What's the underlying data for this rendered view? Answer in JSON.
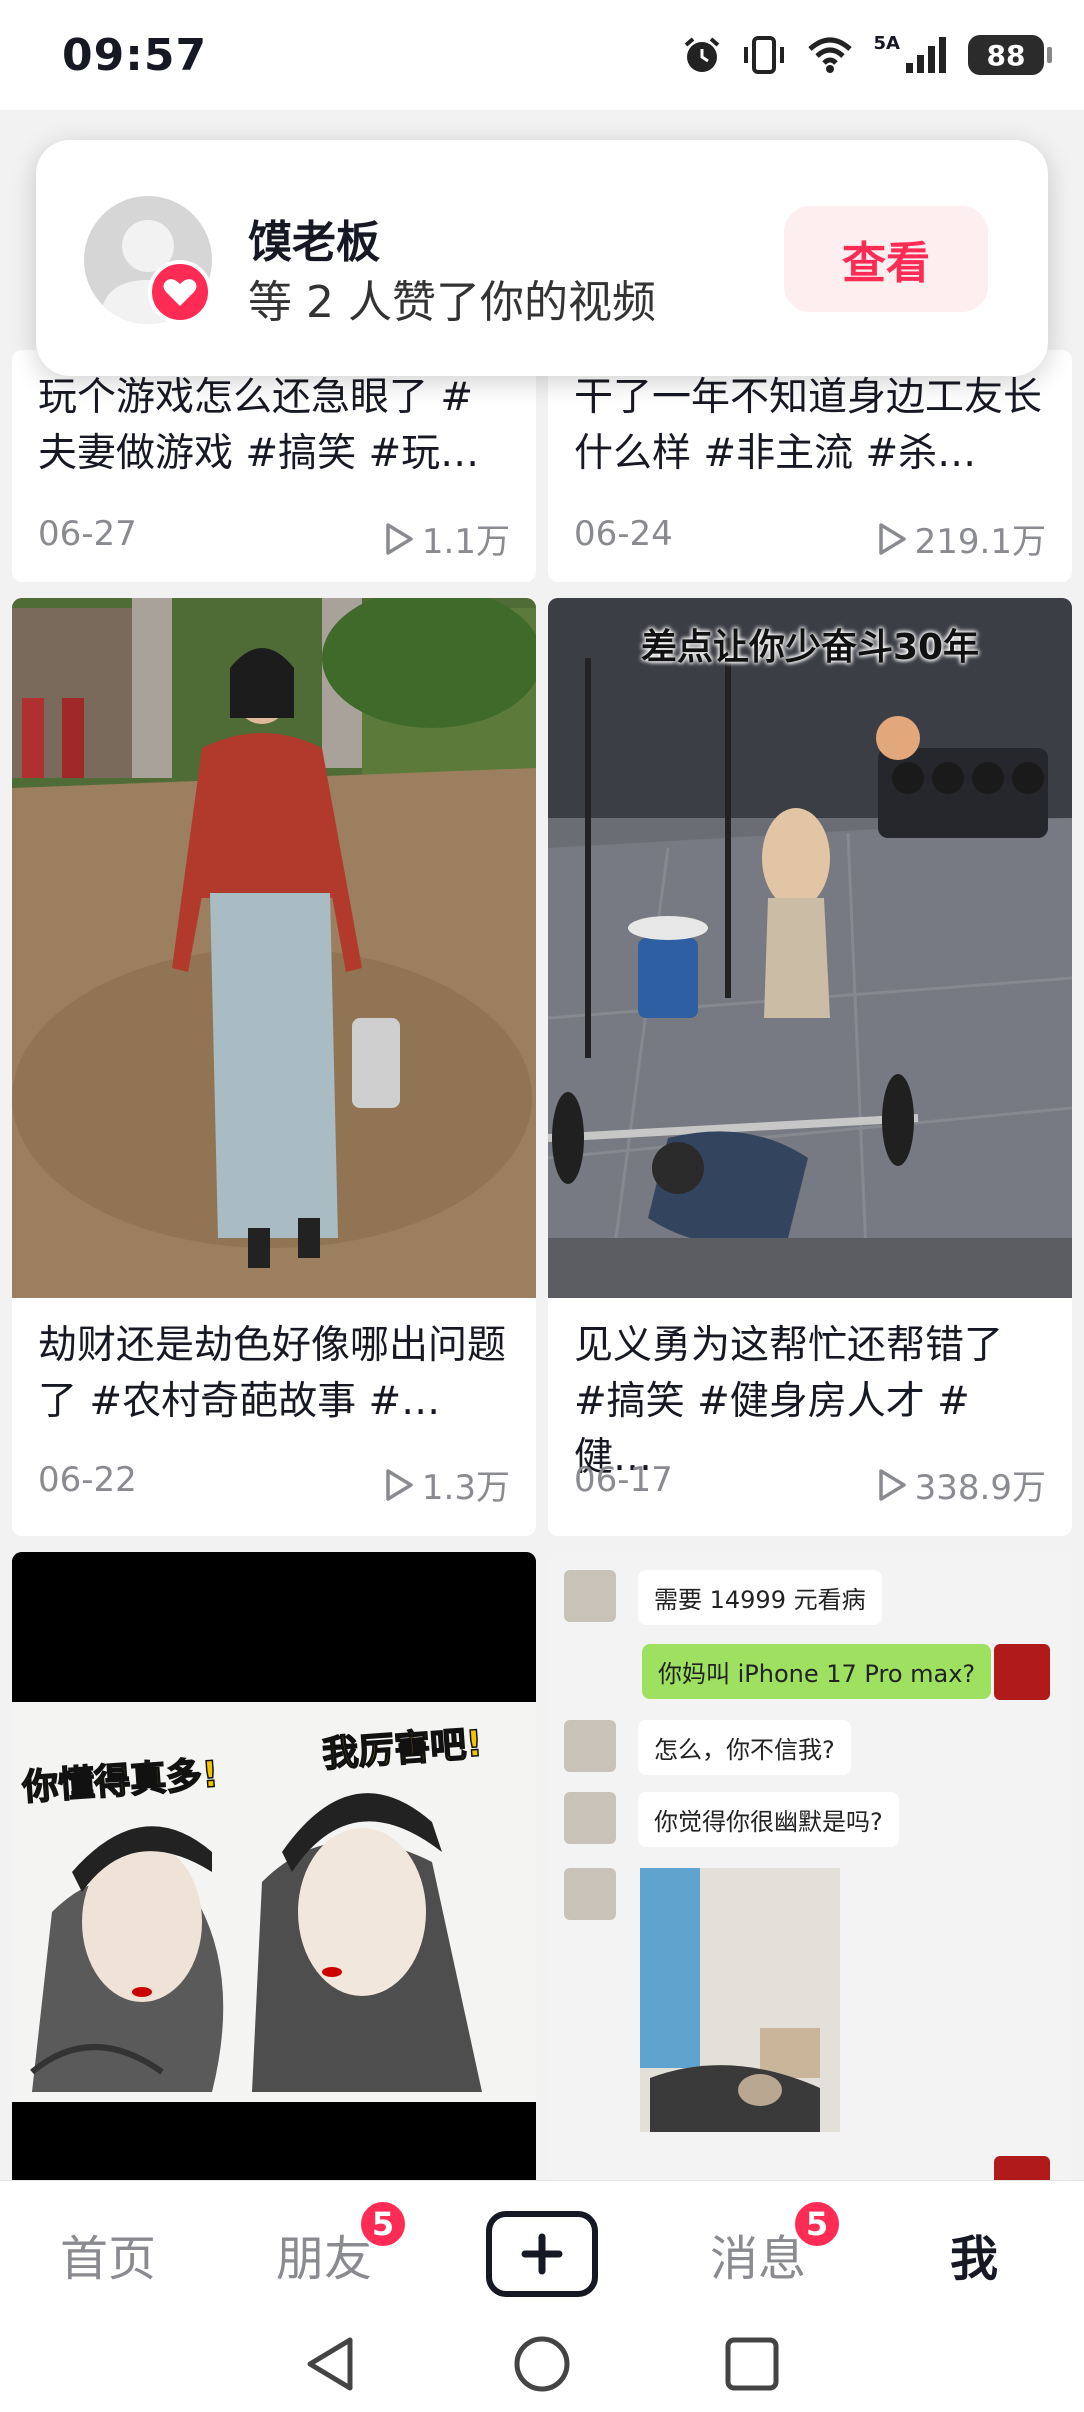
{
  "status_bar": {
    "time": "09:57",
    "network_label": "5A",
    "battery": "88",
    "icons": [
      "alarm-icon",
      "vibrate-icon",
      "wifi-icon",
      "signal-icon",
      "battery-icon"
    ]
  },
  "notification": {
    "name": "馍老板",
    "message": "等 2 人赞了你的视频",
    "button": "查看",
    "icons": [
      "avatar-placeholder-icon",
      "heart-icon"
    ]
  },
  "videos": [
    {
      "title": "玩个游戏怎么还急眼了 #夫妻做游戏 #搞笑 #玩…",
      "date": "06-27",
      "plays": "1.1万"
    },
    {
      "title": "干了一年不知道身边工友长什么样 #非主流 #杀…",
      "date": "06-24",
      "plays": "219.1万"
    },
    {
      "title": "劫财还是劫色好像哪出问题了 #农村奇葩故事 #…",
      "date": "06-22",
      "plays": "1.3万"
    },
    {
      "title": "见义勇为这帮忙还帮错了 #搞笑 #健身房人才 #健…",
      "date": "06-17",
      "plays": "338.9万"
    }
  ],
  "thumbnails": {
    "gym_caption": "差点让你少奋斗30年",
    "cartoon_left": "你懂得真多!",
    "cartoon_right": "我厉害吧!",
    "chat": {
      "msg1": "需要 14999 元看病",
      "msg2": "你妈叫 iPhone 17 Pro max?",
      "msg3": "怎么，你不信我?",
      "msg4": "你觉得你很幽默是吗?"
    }
  },
  "bottom_nav": {
    "home": "首页",
    "friends": "朋友",
    "friends_badge": "5",
    "messages": "消息",
    "messages_badge": "5",
    "me": "我"
  },
  "colors": {
    "accent": "#fe2c55",
    "text": "#161823",
    "muted": "#8a8b91",
    "background": "#f2f2f2"
  }
}
